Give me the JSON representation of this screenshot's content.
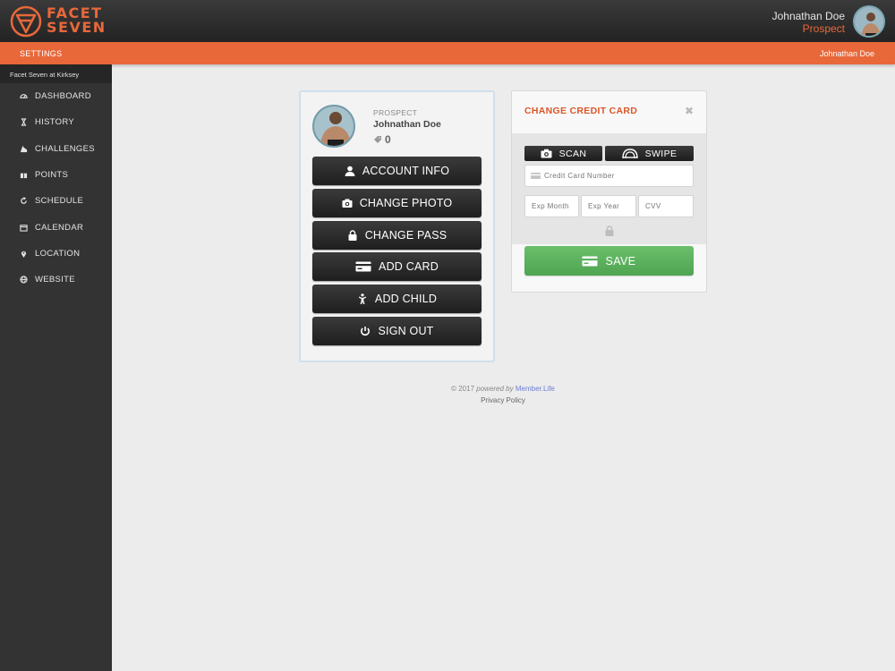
{
  "header": {
    "brand_line1": "FACET",
    "brand_line2": "SEVEN",
    "user_name": "Johnathan Doe",
    "user_role": "Prospect",
    "brand_color": "#e8683a"
  },
  "subheader": {
    "section": "SETTINGS",
    "user_name": "Johnathan Doe"
  },
  "sidebar": {
    "gym": "Facet Seven at Kirksey",
    "items": [
      {
        "label": "DASHBOARD",
        "icon": "dashboard-icon"
      },
      {
        "label": "HISTORY",
        "icon": "hourglass-icon"
      },
      {
        "label": "CHALLENGES",
        "icon": "challenge-icon"
      },
      {
        "label": "POINTS",
        "icon": "gift-icon"
      },
      {
        "label": "SCHEDULE",
        "icon": "refresh-icon"
      },
      {
        "label": "CALENDAR",
        "icon": "calendar-icon"
      },
      {
        "label": "LOCATION",
        "icon": "map-pin-icon"
      },
      {
        "label": "WEBSITE",
        "icon": "globe-icon"
      }
    ]
  },
  "profile": {
    "role": "PROSPECT",
    "name": "Johnathan Doe",
    "points": "0",
    "buttons": [
      {
        "label": "ACCOUNT INFO",
        "icon": "user-icon"
      },
      {
        "label": "CHANGE PHOTO",
        "icon": "camera-icon"
      },
      {
        "label": "CHANGE PASS",
        "icon": "lock-icon"
      },
      {
        "label": "ADD CARD",
        "icon": "credit-card-icon"
      },
      {
        "label": "ADD CHILD",
        "icon": "child-icon"
      },
      {
        "label": "SIGN OUT",
        "icon": "power-icon"
      }
    ]
  },
  "credit_card": {
    "title": "CHANGE CREDIT CARD",
    "close": "✖",
    "scan_label": "SCAN",
    "swipe_label": "SWIPE",
    "number_placeholder": "Credit Card Number",
    "month_placeholder": "Exp Month",
    "year_placeholder": "Exp Year",
    "cvv_placeholder": "CVV",
    "save_label": "SAVE",
    "save_color": "#5cb35f"
  },
  "footer": {
    "copyright": "© 2017",
    "powered_by": "powered by",
    "link": "Member.Life",
    "privacy": "Privacy Policy"
  }
}
